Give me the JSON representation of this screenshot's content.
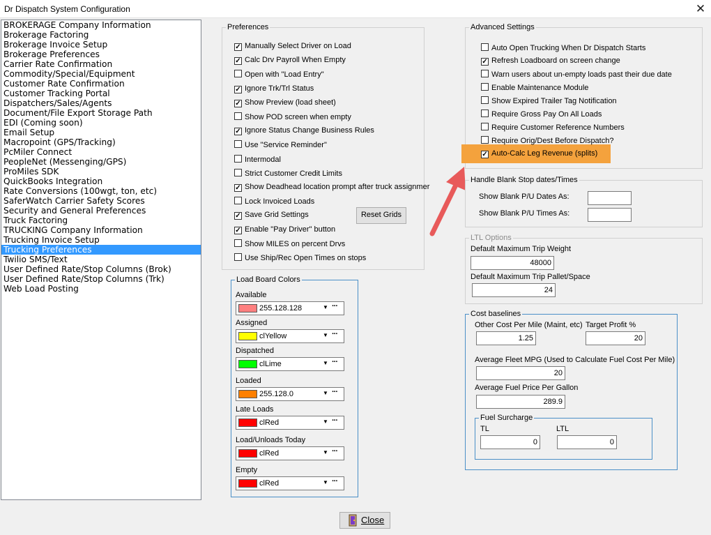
{
  "window": {
    "title": "Dr Dispatch  System Configuration"
  },
  "nav": {
    "items": [
      "BROKERAGE Company Information",
      "Brokerage Factoring",
      "Brokerage Invoice Setup",
      "Brokerage Preferences",
      "Carrier Rate Confirmation",
      "Commodity/Special/Equipment",
      "Customer Rate Confirmation",
      "Customer Tracking Portal",
      "Dispatchers/Sales/Agents",
      "Document/File Export Storage Path",
      "EDI (Coming soon)",
      "Email Setup",
      "Macropoint (GPS/Tracking)",
      "PcMiler Connect",
      "PeopleNet (Messenging/GPS)",
      "ProMiles SDK",
      "QuickBooks Integration",
      "Rate Conversions (100wgt, ton, etc)",
      "SaferWatch Carrier Safety Scores",
      "Security and General Preferences",
      "Truck Factoring",
      "TRUCKING Company Information",
      "Trucking Invoice Setup",
      "Trucking Preferences",
      "Twilio SMS/Text",
      "User Defined Rate/Stop Columns (Brok)",
      "User Defined Rate/Stop Columns (Trk)",
      "Web Load Posting"
    ],
    "selected": "Trucking Preferences"
  },
  "preferences": {
    "title": "Preferences",
    "items": [
      {
        "label": "Manually Select Driver on Load",
        "checked": true
      },
      {
        "label": "Calc Drv Payroll When Empty",
        "checked": true
      },
      {
        "label": "Open with \"Load Entry\"",
        "checked": false
      },
      {
        "label": "Ignore Trk/Trl Status",
        "checked": true
      },
      {
        "label": "Show Preview (load sheet)",
        "checked": true
      },
      {
        "label": "Show POD screen when empty",
        "checked": false
      },
      {
        "label": "Ignore Status Change Business Rules",
        "checked": true
      },
      {
        "label": "Use \"Service Reminder\"",
        "checked": false
      },
      {
        "label": "Intermodal",
        "checked": false
      },
      {
        "label": "Strict Customer Credit Limits",
        "checked": false
      },
      {
        "label": "Show Deadhead location prompt after truck assignmer",
        "checked": true
      },
      {
        "label": "Lock Invoiced Loads",
        "checked": false
      },
      {
        "label": "Save Grid Settings",
        "checked": true
      },
      {
        "label": "Enable \"Pay Driver\" button",
        "checked": true
      },
      {
        "label": "Show MILES on percent Drvs",
        "checked": false
      },
      {
        "label": "Use Ship/Rec Open Times on stops",
        "checked": false
      }
    ],
    "reset_grids_label": "Reset Grids"
  },
  "load_board_colors": {
    "title": "Load Board Colors",
    "items": [
      {
        "label": "Available",
        "value": "255.128.128",
        "color": "#ff8080"
      },
      {
        "label": "Assigned",
        "value": "clYellow",
        "color": "#ffff00"
      },
      {
        "label": "Dispatched",
        "value": "clLime",
        "color": "#00ff00"
      },
      {
        "label": "Loaded",
        "value": "255.128.0",
        "color": "#ff8000"
      },
      {
        "label": "Late Loads",
        "value": "clRed",
        "color": "#ff0000"
      },
      {
        "label": "Load/Unloads Today",
        "value": "clRed",
        "color": "#ff0000"
      },
      {
        "label": "Empty",
        "value": "clRed",
        "color": "#ff0000"
      }
    ]
  },
  "advanced": {
    "title": "Advanced Settings",
    "items": [
      {
        "label": "Auto Open Trucking When Dr Dispatch Starts",
        "checked": false
      },
      {
        "label": "Refresh Loadboard on screen change",
        "checked": true
      },
      {
        "label": "Warn users about un-empty loads past their due date",
        "checked": false
      },
      {
        "label": "Enable Maintenance Module",
        "checked": false
      },
      {
        "label": "Show Expired Trailer Tag Notification",
        "checked": false
      },
      {
        "label": "Require Gross Pay On All Loads",
        "checked": false
      },
      {
        "label": "Require Customer Reference Numbers",
        "checked": false
      },
      {
        "label": "Require Orig/Dest Before Dispatch?",
        "checked": false
      },
      {
        "label": "Auto-Calc Leg Revenue (splits)",
        "checked": true
      }
    ],
    "highlight_color": "#f4a23d"
  },
  "blank_stop": {
    "title": "Handle Blank Stop dates/Times",
    "dates_label": "Show Blank P/U Dates As:",
    "times_label": "Show Blank P/U Times As:",
    "dates_value": "",
    "times_value": ""
  },
  "ltl": {
    "title": "LTL Options",
    "max_weight_label": "Default Maximum Trip Weight",
    "max_weight": "48000",
    "max_pallet_label": "Default Maximum Trip Pallet/Space",
    "max_pallet": "24"
  },
  "cost": {
    "title": "Cost baselines",
    "other_cost_label": "Other Cost Per Mile (Maint, etc)",
    "other_cost": "1.25",
    "target_profit_label": "Target Profit %",
    "target_profit": "20",
    "avg_mpg_label": "Average Fleet MPG (Used to Calculate Fuel Cost Per Mile)",
    "avg_mpg": "20",
    "avg_fuel_label": "Average Fuel Price Per Gallon",
    "avg_fuel": "289.9",
    "fuel_surcharge": {
      "title": "Fuel Surcharge",
      "tl_label": "TL",
      "tl_value": "0",
      "ltl_label": "LTL",
      "ltl_value": "0"
    }
  },
  "footer": {
    "close_label": "Close"
  }
}
